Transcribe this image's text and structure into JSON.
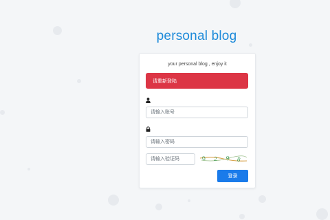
{
  "header": {
    "title": "personal blog"
  },
  "card": {
    "subtitle": "your personal blog , enjoy it",
    "alert_text": "请重新登陆",
    "username": {
      "icon": "user-icon",
      "placeholder": "请输入账号",
      "value": ""
    },
    "password": {
      "icon": "lock-icon",
      "placeholder": "请输入密码",
      "value": ""
    },
    "captcha": {
      "placeholder": "请输入验证码",
      "value": "",
      "image_text": "0 2 9 8"
    },
    "login_label": "登录"
  },
  "colors": {
    "brand_title": "#1d8ad9",
    "alert_bg": "#dc3545",
    "primary_button": "#1a7bea",
    "captcha_text": "#3f9a52",
    "captcha_line": "#d6a24a"
  }
}
